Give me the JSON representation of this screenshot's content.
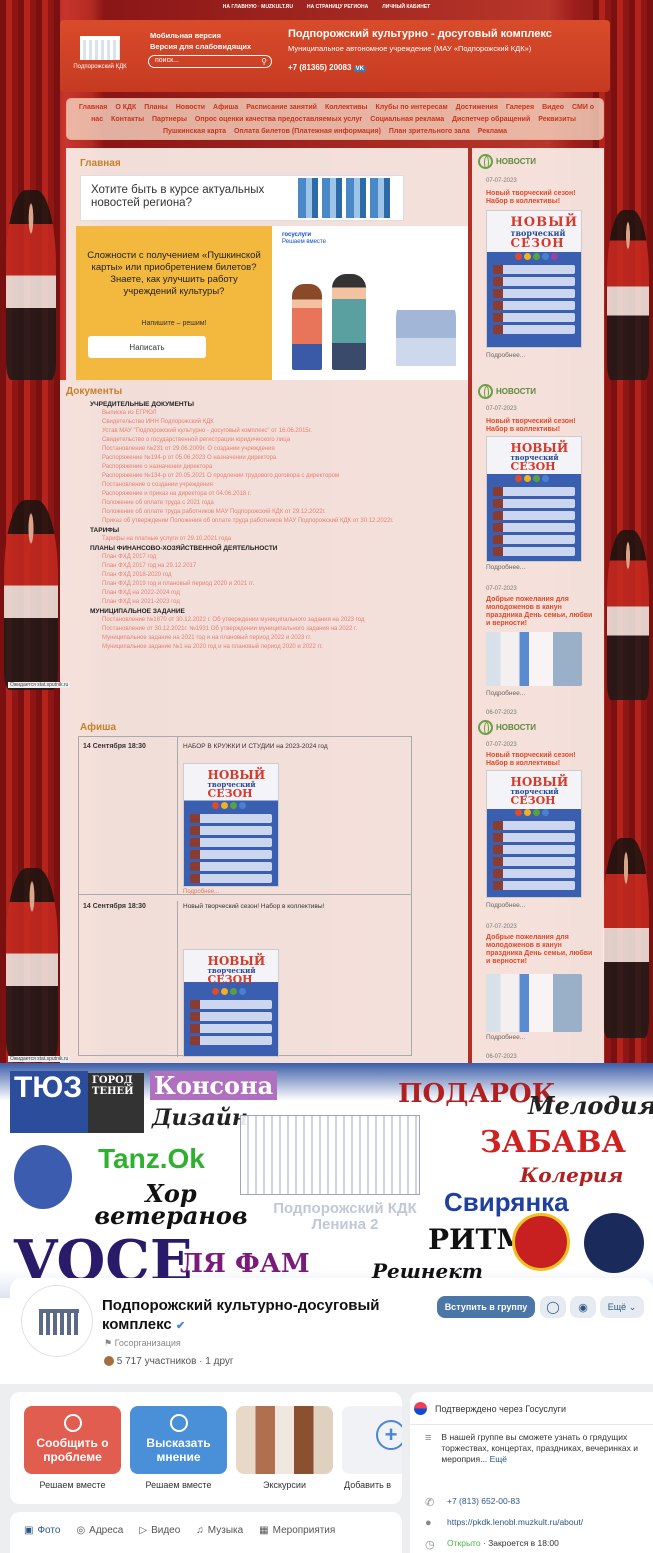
{
  "topbar": {
    "items": [
      "НА ГЛАВНУЮ · MUZKULT.RU",
      "НА СТРАНИЦУ РЕГИОНА",
      "ЛИЧНЫЙ КАБИНЕТ"
    ]
  },
  "header": {
    "logo_caption": "Подпорожский КДК",
    "mobile_label": "Мобильная версия",
    "impaired_label": "Версия для слабовидящих",
    "search_placeholder": "поиск...",
    "title": "Подпорожский культурно - досуговый комплекс",
    "subtitle": "Муниципальное автономное учреждение (МАУ «Подпорожский КДК»)",
    "phone": "+7 (81365) 20083",
    "social": "VK"
  },
  "menu": {
    "items": [
      "Главная",
      "О КДК",
      "Планы",
      "Новости",
      "Афиша",
      "Расписание занятий",
      "Коллективы",
      "Клубы по интересам",
      "Достижения",
      "Галерея",
      "Видео",
      "СМИ о нас",
      "Контакты",
      "Партнеры",
      "Опрос оценки качества предоставляемых услуг",
      "Социальная реклама",
      "Диспетчер обращений",
      "Реквизиты",
      "Пушкинская карта",
      "Оплата билетов (Платежная информация)",
      "План зрительного зала",
      "Реклама"
    ]
  },
  "main_page": {
    "title": "Главная",
    "banner_text": "Хотите быть в курсе актуальных новостей региона?",
    "promo_text": "Сложности с получением «Пушкинской карты» или приобретением билетов? Знаете, как улучшить работу учреждений культуры?",
    "promo_sub": "Напишите – решим!",
    "promo_button": "Написать",
    "gosuslugi": "госуслуги",
    "gosuslugi_sub": "Решаем вместе"
  },
  "news": {
    "title": "НОВОСТИ",
    "poster_word_1": "НОВЫЙ",
    "poster_word_2": "творческий",
    "poster_word_3": "СЕЗОН",
    "more": "Подробнее...",
    "items": [
      {
        "date": "07-07-2023",
        "title": "Новый творческий сезон! Набор в коллективы!"
      },
      {
        "date": "07-07-2023",
        "title": "Добрые пожелания для молодоженов в канун праздника День семьи, любви и верности!"
      },
      {
        "date": "06-07-2023",
        "title": ""
      }
    ]
  },
  "documents": {
    "title": "Документы",
    "sections": [
      {
        "heading": "УЧРЕДИТЕЛЬНЫЕ ДОКУМЕНТЫ",
        "links": [
          "Выписка из ЕГРЮЛ",
          "Свидетельство ИНН Подпорожский КДК",
          "Устав МАУ \"Подпорожский культурно - досуговый комплекс\" от 16.06.2015г.",
          "Свидетельство о государственной регистрации юридического лица",
          "Постановление №231 от 29.06.2009г. О создании учреждения",
          "Распоряжение №194-р от 05.06.2023 О назначении директора",
          "Распоряжение о назначении директора",
          "Распоряжение №134-р от 20.05.2021 О продлении трудового договора с директором",
          "Постановление о создании учреждения",
          "Распоряжение и приказ на директора от 04.06.2018 г.",
          "Положение об оплате труда с 2021 года",
          "Положение об оплате труда работников МАУ Подпорожский КДК от 29.12.2022г.",
          "Приказ об утверждении Положения об оплате труда работников МАУ Подпорожский КДК от 30.12.2022г."
        ]
      },
      {
        "heading": "ТАРИФЫ",
        "links": [
          "Тарифы на платные услуги от 29.10.2021 года"
        ]
      },
      {
        "heading": "ПЛАНЫ ФИНАНСОВО-ХОЗЯЙСТВЕННОЙ ДЕЯТЕЛЬНОСТИ",
        "links": [
          "План ФХД 2017 год",
          "План ФХД 2017 год на 29.12.2017",
          "План ФХД 2018-2020 год",
          "План ФХД 2019 год и плановый период 2020 и 2021 гг.",
          "План ФХД на 2022-2024 год",
          "План ФХД на 2021-2023 год"
        ]
      },
      {
        "heading": "МУНИЦИПАЛЬНОЕ ЗАДАНИЕ",
        "links": [
          "Постановление №1870 от 30.12.2022 г. Об утверждении муниципального задания на 2023 год",
          "Постановление от 30.12.2021г. №1931 Об утверждении муниципального задания на 2022 г.",
          "Муниципальное задание на 2021 год и на плановый период 2022 и 2023 гг.",
          "Муниципальное задание №1 на 2020 год и на плановый период 2020 и 2022 гг."
        ]
      }
    ]
  },
  "afisha": {
    "title": "Афиша",
    "events": [
      {
        "date": "14 Сентября 18:30",
        "title": "НАБОР В КРУЖКИ И СТУДИИ на 2023-2024 год",
        "more": "Подробнее..."
      },
      {
        "date": "14 Сентября 18:30",
        "title": "Новый творческий сезон! Набор в коллективы!",
        "more": ""
      }
    ]
  },
  "status_bar": "Ожидается stat.sputnik.ru",
  "vk": {
    "banner_words": [
      "ТЮЗ",
      "ГОРОД ТЕНЕЙ",
      "Консона",
      "Дизайн",
      "ПОДАРОК",
      "Мелодия",
      "ЗАБАВА",
      "Колерия",
      "Tanz.Ok",
      "Хор ветеранов",
      "Подпорожский КДК Ленина 2",
      "Свирянка",
      "РИТМ",
      "VOCE",
      "ЛЯ ФАМ",
      "Решнект"
    ],
    "group_name": "Подпорожский культурно-досуговый комплекс",
    "category": "Госорганизация",
    "members": "5 717 участников · 1 друг",
    "join_button": "Вступить в группу",
    "more_button": "Ещё",
    "actions": [
      {
        "label": "Сообщить о проблеме",
        "caption": "Решаем вместе",
        "color": "#e15d4f"
      },
      {
        "label": "Высказать мнение",
        "caption": "Решаем вместе",
        "color": "#4a90d8"
      },
      {
        "label": "",
        "caption": "Экскурсии",
        "color": "#c9a07a"
      },
      {
        "label": "",
        "caption": "Добавить в",
        "color": "#f0f2f5"
      }
    ],
    "verified": "Подтверждено через Госуслуги",
    "description": "В нашей группе вы сможете узнать о грядущих торжествах, концертах, праздниках, вечеринках и мероприя...",
    "description_more": "Ещё",
    "phone": "+7 (813) 652-00-83",
    "site": "https://pkdk.lenobl.muzkult.ru/about/",
    "open_label": "Открыто",
    "open_time": "· Закроется в 18:00",
    "tabs": [
      "Фото",
      "Адреса",
      "Видео",
      "Музыка",
      "Мероприятия"
    ]
  }
}
